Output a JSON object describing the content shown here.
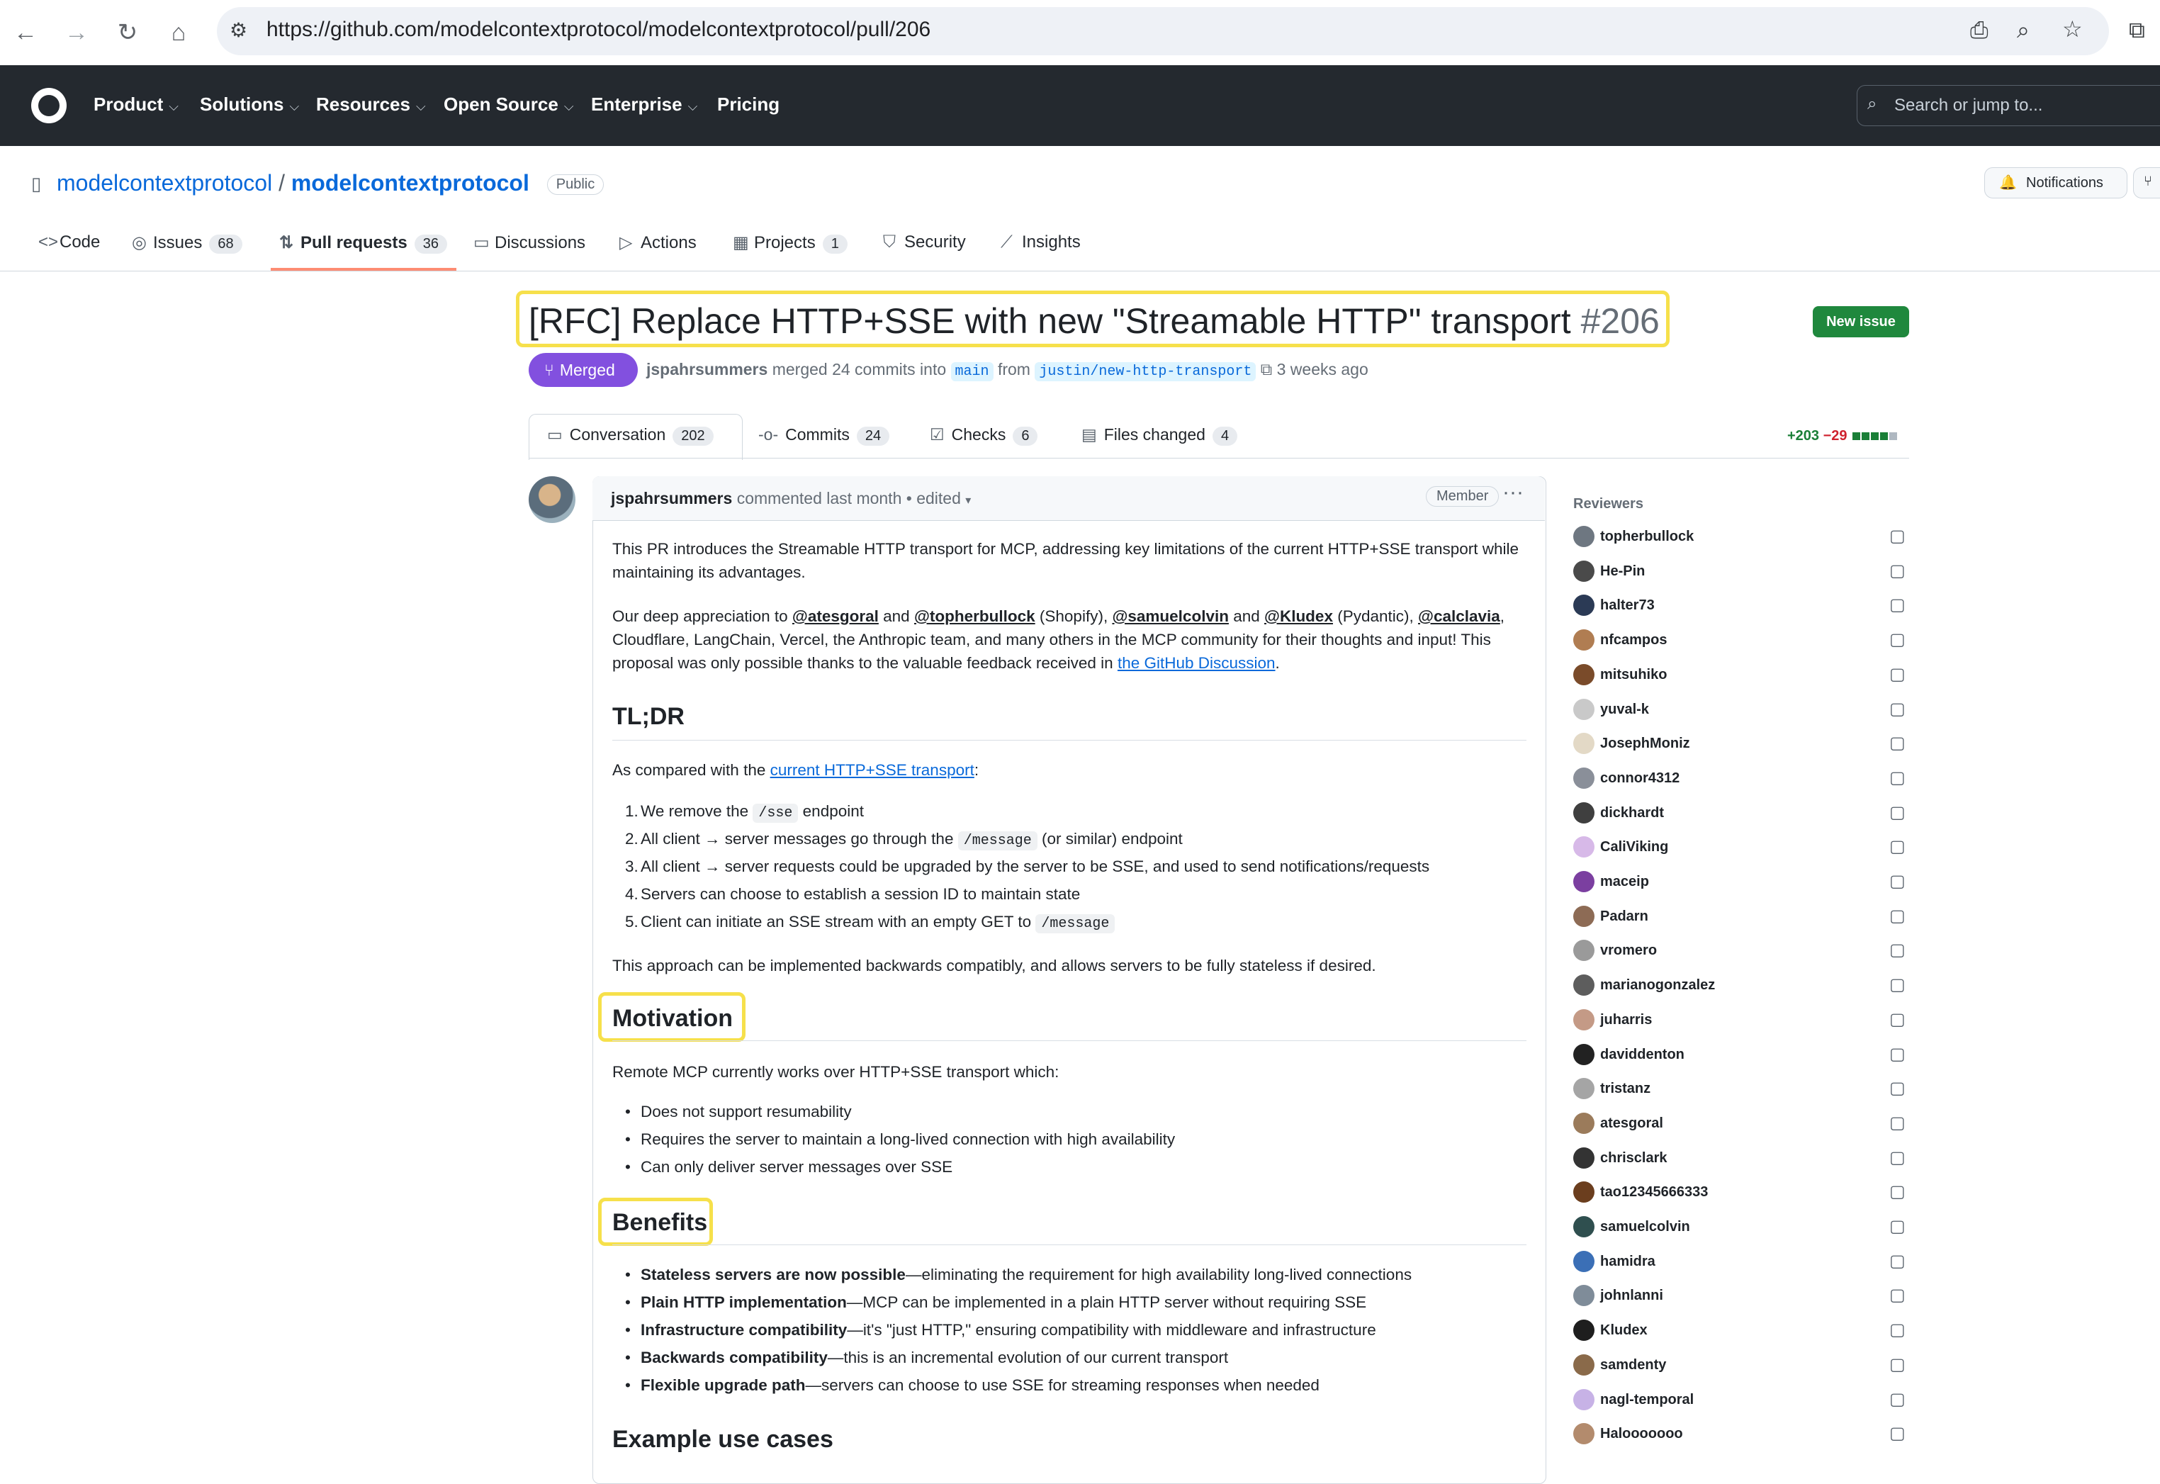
{
  "browser": {
    "url": "https://github.com/modelcontextprotocol/modelcontextprotocol/pull/206"
  },
  "gh_nav": {
    "items": [
      "Product",
      "Solutions",
      "Resources",
      "Open Source",
      "Enterprise",
      "Pricing"
    ],
    "search_placeholder": "Search or jump to..."
  },
  "repo": {
    "owner": "modelcontextprotocol",
    "separator": "/",
    "name": "modelcontextprotocol",
    "visibility": "Public",
    "notifications_label": "Notifications",
    "tabs": [
      {
        "label": "Code",
        "count": ""
      },
      {
        "label": "Issues",
        "count": "68"
      },
      {
        "label": "Pull requests",
        "count": "36"
      },
      {
        "label": "Discussions",
        "count": ""
      },
      {
        "label": "Actions",
        "count": ""
      },
      {
        "label": "Projects",
        "count": "1"
      },
      {
        "label": "Security",
        "count": ""
      },
      {
        "label": "Insights",
        "count": ""
      }
    ]
  },
  "pr": {
    "title": "[RFC] Replace HTTP+SSE with new \"Streamable HTTP\" transport",
    "number": "#206",
    "new_issue_label": "New issue",
    "state": "Merged",
    "author": "jspahrsummers",
    "merge_text": "merged 24 commits into",
    "base_branch": "main",
    "from_text": "from",
    "head_branch": "justin/new-http-transport",
    "time": "3 weeks ago",
    "tabs": [
      {
        "label": "Conversation",
        "count": "202"
      },
      {
        "label": "Commits",
        "count": "24"
      },
      {
        "label": "Checks",
        "count": "6"
      },
      {
        "label": "Files changed",
        "count": "4"
      }
    ],
    "additions": "+203",
    "deletions": "−29"
  },
  "comment": {
    "author": "jspahrsummers",
    "meta": "commented last month • edited",
    "role": "Member",
    "intro": "This PR introduces the Streamable HTTP transport for MCP, addressing key limitations of the current HTTP+SSE transport while maintaining its advantages.",
    "thanks": {
      "p1": "Our deep appreciation to ",
      "m1": "@atesgoral",
      "p2": " and ",
      "m2": "@topherbullock",
      "p3": " (Shopify), ",
      "m3": "@samuelcolvin",
      "p4": " and ",
      "m4": "@Kludex",
      "p5": " (Pydantic), ",
      "m5": "@calclavia",
      "p6": ", Cloudflare, LangChain, Vercel, the Anthropic team, and many others in the MCP community for their thoughts and input! This proposal was only possible thanks to the valuable feedback received in ",
      "link": "the GitHub Discussion",
      "p7": "."
    },
    "tldr_heading": "TL;DR",
    "compared_pre": "As compared with the ",
    "compared_link": "current HTTP+SSE transport",
    "compared_post": ":",
    "tldr_items": [
      {
        "n": "1.",
        "pre": "We remove the ",
        "code": "/sse",
        "post": " endpoint"
      },
      {
        "n": "2.",
        "pre": "All client → server messages go through the ",
        "code": "/message",
        "post": " (or similar) endpoint"
      },
      {
        "n": "3.",
        "pre": "All client → server requests could be upgraded by the server to be SSE, and used to send notifications/requests",
        "code": "",
        "post": ""
      },
      {
        "n": "4.",
        "pre": "Servers can choose to establish a session ID to maintain state",
        "code": "",
        "post": ""
      },
      {
        "n": "5.",
        "pre": "Client can initiate an SSE stream with an empty GET to ",
        "code": "/message",
        "post": ""
      }
    ],
    "approach": "This approach can be implemented backwards compatibly, and allows servers to be fully stateless if desired.",
    "motivation_heading": "Motivation",
    "motivation_intro": "Remote MCP currently works over HTTP+SSE transport which:",
    "motivation_items": [
      "Does not support resumability",
      "Requires the server to maintain a long-lived connection with high availability",
      "Can only deliver server messages over SSE"
    ],
    "benefits_heading": "Benefits",
    "benefits_items": [
      {
        "bold": "Stateless servers are now possible",
        "rest": "—eliminating the requirement for high availability long-lived connections"
      },
      {
        "bold": "Plain HTTP implementation",
        "rest": "—MCP can be implemented in a plain HTTP server without requiring SSE"
      },
      {
        "bold": "Infrastructure compatibility",
        "rest": "—it's \"just HTTP,\" ensuring compatibility with middleware and infrastructure"
      },
      {
        "bold": "Backwards compatibility",
        "rest": "—this is an incremental evolution of our current transport"
      },
      {
        "bold": "Flexible upgrade path",
        "rest": "—servers can choose to use SSE for streaming responses when needed"
      }
    ],
    "examples_heading": "Example use cases"
  },
  "sidebar": {
    "reviewers_title": "Reviewers",
    "reviewers": [
      {
        "name": "topherbullock",
        "color": "#6e7781"
      },
      {
        "name": "He-Pin",
        "color": "#4a4a4a"
      },
      {
        "name": "halter73",
        "color": "#2b3a55"
      },
      {
        "name": "nfcampos",
        "color": "#b07d52"
      },
      {
        "name": "mitsuhiko",
        "color": "#7a4b2a"
      },
      {
        "name": "yuval-k",
        "color": "#c9c9c9"
      },
      {
        "name": "JosephMoniz",
        "color": "#e3d9c6"
      },
      {
        "name": "connor4312",
        "color": "#8a8f99"
      },
      {
        "name": "dickhardt",
        "color": "#3f3f3f"
      },
      {
        "name": "CaliViking",
        "color": "#d7b9e8"
      },
      {
        "name": "maceip",
        "color": "#7b3fa0"
      },
      {
        "name": "Padarn",
        "color": "#8d6b55"
      },
      {
        "name": "vromero",
        "color": "#9a9a9a"
      },
      {
        "name": "marianogonzalez",
        "color": "#5d5d5d"
      },
      {
        "name": "juharris",
        "color": "#c49a86"
      },
      {
        "name": "daviddenton",
        "color": "#222222"
      },
      {
        "name": "tristanz",
        "color": "#a5a5a5"
      },
      {
        "name": "atesgoral",
        "color": "#9b7b5b"
      },
      {
        "name": "chrisclark",
        "color": "#333333"
      },
      {
        "name": "tao12345666333",
        "color": "#6b3e1e"
      },
      {
        "name": "samuelcolvin",
        "color": "#2f4f4f"
      },
      {
        "name": "hamidra",
        "color": "#3b6fb6"
      },
      {
        "name": "johnlanni",
        "color": "#7f8c99"
      },
      {
        "name": "Kludex",
        "color": "#1e1e1e"
      },
      {
        "name": "samdenty",
        "color": "#8a6a4a"
      },
      {
        "name": "nagl-temporal",
        "color": "#c7b2e6"
      },
      {
        "name": "Halooooooo",
        "color": "#b38b6d"
      }
    ]
  }
}
